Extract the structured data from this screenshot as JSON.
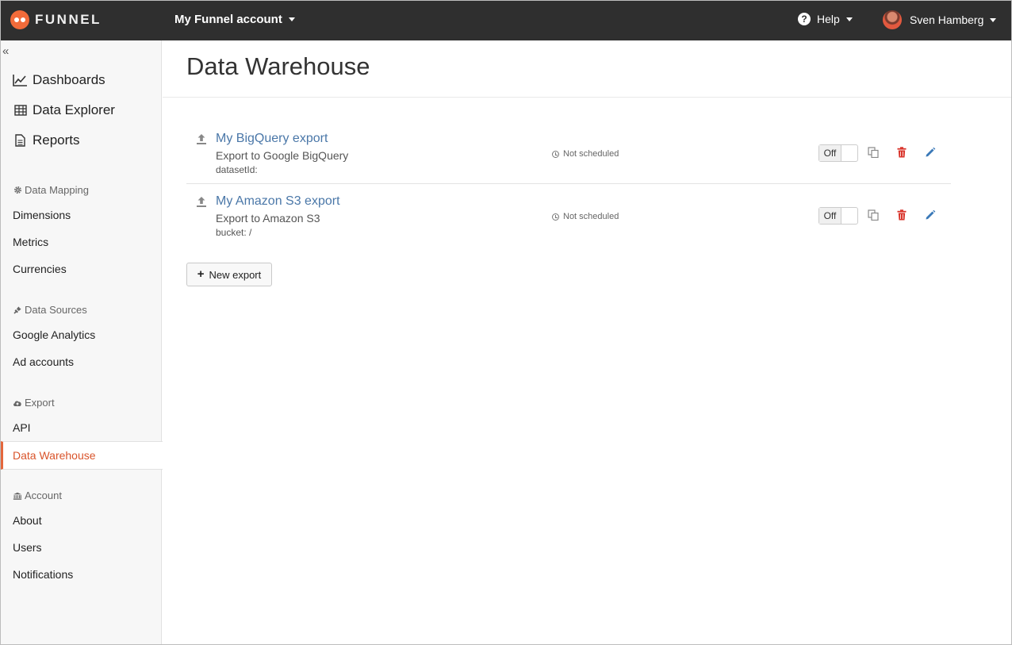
{
  "brand": {
    "name": "FUNNEL",
    "accent": "#f26b3a"
  },
  "topbar": {
    "account": "My Funnel account",
    "help": "Help",
    "user": "Sven Hamberg",
    "colors": {
      "background": "#2f2f2f"
    }
  },
  "sidebar": {
    "main": [
      {
        "label": "Dashboards",
        "icon": "line-chart-icon"
      },
      {
        "label": "Data Explorer",
        "icon": "table-icon"
      },
      {
        "label": "Reports",
        "icon": "document-icon"
      }
    ],
    "sections": [
      {
        "title": "Data Mapping",
        "icon": "gear-icon",
        "items": [
          "Dimensions",
          "Metrics",
          "Currencies"
        ]
      },
      {
        "title": "Data Sources",
        "icon": "plug-icon",
        "items": [
          "Google Analytics",
          "Ad accounts"
        ]
      },
      {
        "title": "Export",
        "icon": "cloud-upload-icon",
        "items": [
          "API",
          "Data Warehouse"
        ]
      },
      {
        "title": "Account",
        "icon": "bank-icon",
        "items": [
          "About",
          "Users",
          "Notifications"
        ]
      }
    ],
    "active_item": "Data Warehouse"
  },
  "page": {
    "title": "Data Warehouse",
    "exports": [
      {
        "name": "My BigQuery export",
        "description": "Export to Google BigQuery",
        "param": "datasetId:",
        "schedule": "Not scheduled",
        "toggle": "Off"
      },
      {
        "name": "My Amazon S3 export",
        "description": "Export to Amazon S3",
        "param": "bucket: /",
        "schedule": "Not scheduled",
        "toggle": "Off"
      }
    ],
    "new_export_label": "New export"
  },
  "colors": {
    "link": "#4a77a8",
    "delete": "#d9342b",
    "edit": "#3b79b8",
    "active": "#d9542b"
  }
}
